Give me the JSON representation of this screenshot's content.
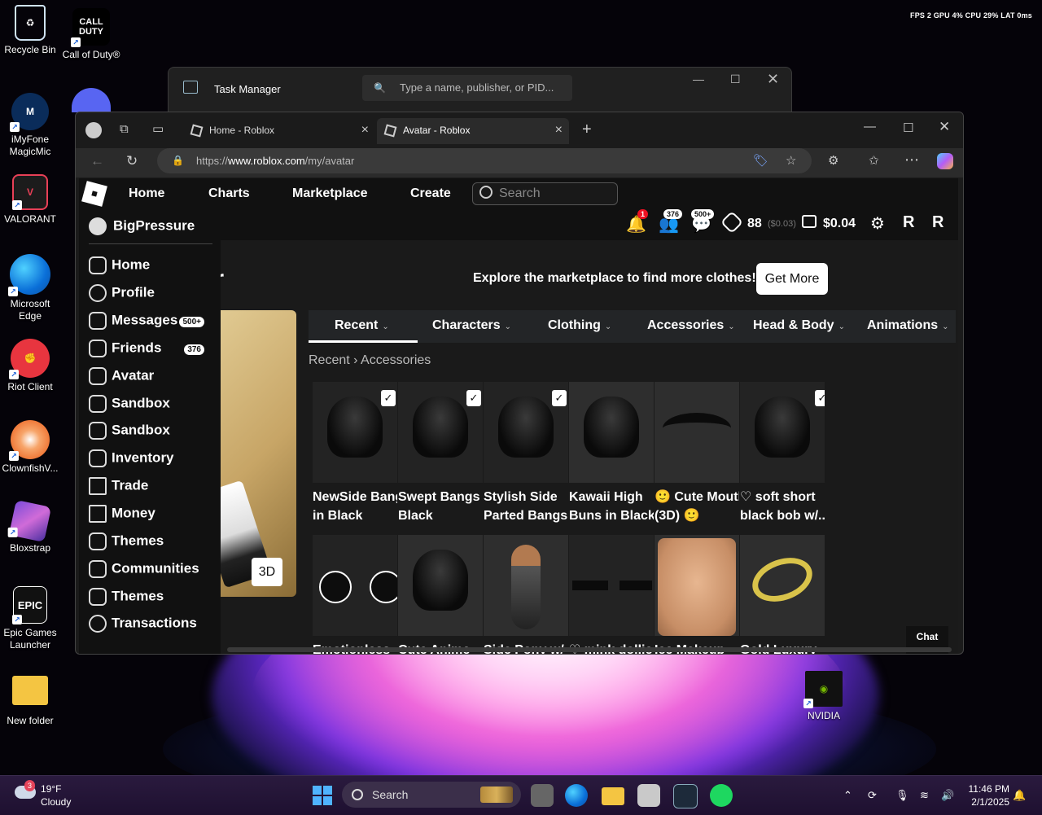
{
  "overlay_stats": "FPS 2 GPU 4% CPU 29% LAT 0ms",
  "desktop_icons": [
    {
      "label": "Recycle Bin",
      "icon": "recycle-bin-icon"
    },
    {
      "label": "Call of Duty®",
      "icon": "call-of-duty-icon"
    },
    {
      "label": "iMyFone MagicMic",
      "icon": "magicmic-icon"
    },
    {
      "label": "VALORANT",
      "icon": "valorant-icon"
    },
    {
      "label": "Microsoft Edge",
      "icon": "edge-icon"
    },
    {
      "label": "Riot Client",
      "icon": "riot-client-icon"
    },
    {
      "label": "ClownfishV...",
      "icon": "clownfish-icon"
    },
    {
      "label": "Bloxstrap",
      "icon": "bloxstrap-icon"
    },
    {
      "label": "Epic Games Launcher",
      "icon": "epic-games-icon"
    },
    {
      "label": "New folder",
      "icon": "folder-icon"
    },
    {
      "label": "NVIDIA",
      "icon": "nvidia-icon"
    }
  ],
  "task_manager": {
    "title": "Task Manager",
    "search_placeholder": "Type a name, publisher, or PID..."
  },
  "browser": {
    "tabs": [
      {
        "label": "Home - Roblox",
        "active": false
      },
      {
        "label": "Avatar - Roblox",
        "active": true
      }
    ],
    "url_prefix": "https://",
    "url_domain": "www.roblox.com",
    "url_path": "/my/avatar"
  },
  "roblox": {
    "nav": [
      "Home",
      "Charts",
      "Marketplace",
      "Create"
    ],
    "search_placeholder": "Search",
    "header": {
      "notifications": "1",
      "friends_count": "376",
      "messages_count": "500+",
      "robux": "88",
      "robux_pending": "($0.03)",
      "balance": "$0.04"
    },
    "page_title": "or",
    "promo_text": "Explore the marketplace to find more clothes!",
    "get_more": "Get More",
    "btn_3d": "3D",
    "categories": [
      "Recent",
      "Characters",
      "Clothing",
      "Accessories",
      "Head & Body",
      "Animations"
    ],
    "breadcrumb": [
      "Recent",
      "Accessories"
    ],
    "items_row1": [
      {
        "line1": "NewSide Bangs",
        "line2": "in Black"
      },
      {
        "line1": "Swept Bangs in",
        "line2": "Black"
      },
      {
        "line1": "Stylish Side",
        "line2": "Parted Bangs..."
      },
      {
        "line1": "Kawaii High",
        "line2": "Buns in Black"
      },
      {
        "line1": "🙂 Cute Mouth",
        "line2": "(3D) 🙂"
      },
      {
        "line1": "♡ soft short",
        "line2": "black bob w/..."
      }
    ],
    "items_row2": [
      {
        "line1": "Emotionless"
      },
      {
        "line1": "Cute Anime"
      },
      {
        "line1": "Side Pony w/"
      },
      {
        "line1": "♡ mink dollie"
      },
      {
        "line1": "Ice Makeup"
      },
      {
        "line1": "Gold Luxury"
      }
    ],
    "chat": "Chat",
    "sidemenu": {
      "username": "BigPressure",
      "items": [
        {
          "label": "Home",
          "icon": "home-icon",
          "badge": ""
        },
        {
          "label": "Profile",
          "icon": "profile-icon",
          "badge": ""
        },
        {
          "label": "Messages",
          "icon": "messages-icon",
          "badge": "500+"
        },
        {
          "label": "Friends",
          "icon": "friends-icon",
          "badge": "376"
        },
        {
          "label": "Avatar",
          "icon": "avatar-icon",
          "badge": ""
        },
        {
          "label": "Sandbox",
          "icon": "sandbox-icon",
          "badge": ""
        },
        {
          "label": "Sandbox",
          "icon": "sandbox-icon",
          "badge": ""
        },
        {
          "label": "Inventory",
          "icon": "inventory-icon",
          "badge": ""
        },
        {
          "label": "Trade",
          "icon": "trade-icon",
          "badge": ""
        },
        {
          "label": "Money",
          "icon": "money-icon",
          "badge": ""
        },
        {
          "label": "Themes",
          "icon": "themes-icon",
          "badge": ""
        },
        {
          "label": "Communities",
          "icon": "communities-icon",
          "badge": ""
        },
        {
          "label": "Themes",
          "icon": "themes-icon",
          "badge": ""
        },
        {
          "label": "Transactions",
          "icon": "transactions-icon",
          "badge": ""
        }
      ]
    }
  },
  "taskbar": {
    "weather_temp": "19°F",
    "weather_desc": "Cloudy",
    "weather_badge": "3",
    "search_placeholder": "Search",
    "time": "11:46 PM",
    "date": "2/1/2025"
  }
}
